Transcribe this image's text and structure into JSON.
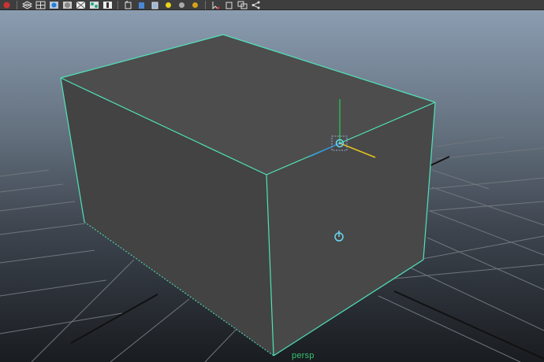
{
  "viewport": {
    "camera_label": "persp"
  },
  "toolbar": {
    "buttons": [
      {
        "name": "render-icon"
      },
      {
        "name": "layer-icon"
      },
      {
        "name": "grid-icon"
      },
      {
        "name": "shaded-icon"
      },
      {
        "name": "sphere-icon"
      },
      {
        "name": "checker-icon"
      },
      {
        "name": "xray-icon"
      },
      {
        "name": "texture-icon"
      },
      {
        "name": "cube-wire-icon"
      },
      {
        "name": "cube-shaded-icon"
      },
      {
        "name": "cube-textured-icon"
      },
      {
        "name": "light-yellow-icon"
      },
      {
        "name": "light-grey-icon"
      },
      {
        "name": "light-gold-icon"
      },
      {
        "name": "select-icon"
      },
      {
        "name": "isolate-icon"
      },
      {
        "name": "duplicate-icon"
      },
      {
        "name": "network-icon"
      }
    ]
  },
  "colors": {
    "wireframe_highlight": "#4fe3b8",
    "object_face": "#484848",
    "grid_line": "#6f767d",
    "axis_line": "#111111",
    "manipulator_cyan": "#6ad5f2",
    "manipulator_green": "#27b84d",
    "manipulator_yellow": "#e6c21c",
    "camera_label": "#34c26e"
  }
}
